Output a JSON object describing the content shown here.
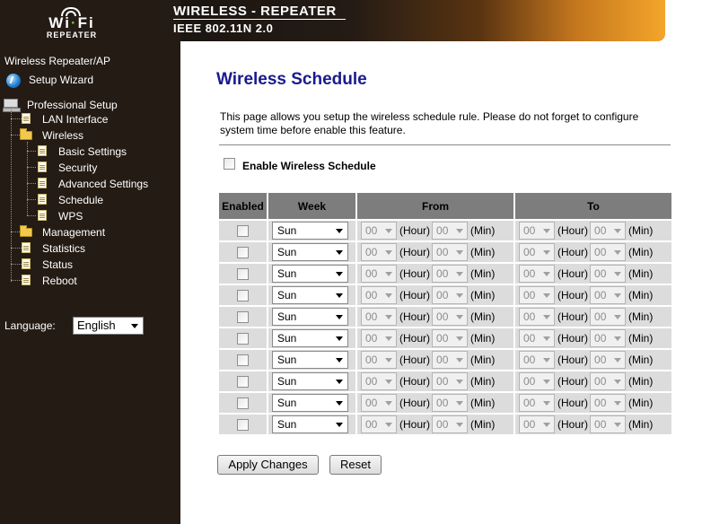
{
  "logo": {
    "wifi_left": "Wi",
    "wifi_right": "Fi",
    "sub": "REPEATER"
  },
  "banner": {
    "line1": "WIRELESS - REPEATER",
    "line2": "IEEE 802.11N 2.0"
  },
  "sidebar": {
    "top_label": "Wireless Repeater/AP",
    "setup_wizard": "Setup Wizard",
    "professional_setup": "Professional Setup",
    "lan_interface": "LAN Interface",
    "wireless": "Wireless",
    "wireless_children": {
      "basic_settings": "Basic Settings",
      "security": "Security",
      "advanced_settings": "Advanced Settings",
      "schedule": "Schedule",
      "wps": "WPS"
    },
    "management": "Management",
    "statistics": "Statistics",
    "status": "Status",
    "reboot": "Reboot",
    "language_label": "Language:",
    "language_value": "English"
  },
  "page": {
    "title": "Wireless Schedule",
    "description": "This page allows you setup the wireless schedule rule. Please do not forget to configure system time before enable this feature.",
    "enable_label": "Enable Wireless Schedule",
    "enable_checked": false
  },
  "table": {
    "headers": {
      "enabled": "Enabled",
      "week": "Week",
      "from": "From",
      "to": "To"
    },
    "units": {
      "hour": "(Hour)",
      "min": "(Min)"
    },
    "rows": [
      {
        "enabled": false,
        "week": "Sun",
        "from_hour": "00",
        "from_min": "00",
        "to_hour": "00",
        "to_min": "00"
      },
      {
        "enabled": false,
        "week": "Sun",
        "from_hour": "00",
        "from_min": "00",
        "to_hour": "00",
        "to_min": "00"
      },
      {
        "enabled": false,
        "week": "Sun",
        "from_hour": "00",
        "from_min": "00",
        "to_hour": "00",
        "to_min": "00"
      },
      {
        "enabled": false,
        "week": "Sun",
        "from_hour": "00",
        "from_min": "00",
        "to_hour": "00",
        "to_min": "00"
      },
      {
        "enabled": false,
        "week": "Sun",
        "from_hour": "00",
        "from_min": "00",
        "to_hour": "00",
        "to_min": "00"
      },
      {
        "enabled": false,
        "week": "Sun",
        "from_hour": "00",
        "from_min": "00",
        "to_hour": "00",
        "to_min": "00"
      },
      {
        "enabled": false,
        "week": "Sun",
        "from_hour": "00",
        "from_min": "00",
        "to_hour": "00",
        "to_min": "00"
      },
      {
        "enabled": false,
        "week": "Sun",
        "from_hour": "00",
        "from_min": "00",
        "to_hour": "00",
        "to_min": "00"
      },
      {
        "enabled": false,
        "week": "Sun",
        "from_hour": "00",
        "from_min": "00",
        "to_hour": "00",
        "to_min": "00"
      },
      {
        "enabled": false,
        "week": "Sun",
        "from_hour": "00",
        "from_min": "00",
        "to_hour": "00",
        "to_min": "00"
      }
    ]
  },
  "buttons": {
    "apply": "Apply Changes",
    "reset": "Reset"
  },
  "colors": {
    "sidebar_bg": "#241b15",
    "title_blue": "#1a1a8c",
    "header_gray": "#7d7d7d",
    "row_gray": "#dcdcdc",
    "banner_orange": "#f4a52a"
  }
}
